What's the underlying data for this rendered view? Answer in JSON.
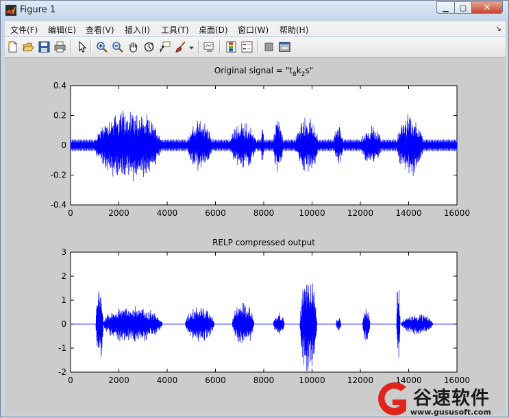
{
  "window": {
    "title": "Figure 1"
  },
  "menu": {
    "items": [
      "文件(F)",
      "编辑(E)",
      "查看(V)",
      "插入(I)",
      "工具(T)",
      "桌面(D)",
      "窗口(W)",
      "帮助(H)"
    ]
  },
  "toolbar": {
    "icons": [
      "new-figure-icon",
      "open-file-icon",
      "save-icon",
      "print-icon",
      "edit-plot-arrow-icon",
      "zoom-in-icon",
      "zoom-out-icon",
      "pan-hand-icon",
      "rotate-3d-icon",
      "data-cursor-icon",
      "brush-icon",
      "brush-dropdown-icon",
      "link-plot-icon",
      "colorbar-icon",
      "legend-icon",
      "hide-plot-tools-icon",
      "show-plot-tools-icon"
    ]
  },
  "colors": {
    "line": "#0000ff",
    "axes_bg": "#ffffff",
    "figure_bg": "#cccccc"
  },
  "watermark": {
    "text": "谷速软件",
    "url": "www.gususoft.com"
  },
  "chart_data": [
    {
      "type": "line",
      "title": "Original signal = \"t",
      "title_sub1": "8",
      "title_mid": "k",
      "title_sub2": "2",
      "title_end": "s\"",
      "xlim": [
        0,
        16000
      ],
      "ylim": [
        -0.4,
        0.4
      ],
      "xticks": [
        "0",
        "2000",
        "4000",
        "6000",
        "8000",
        "10000",
        "12000",
        "14000",
        "16000"
      ],
      "yticks": [
        "0.4",
        "0.2",
        "0",
        "-0.2",
        "-0.4"
      ],
      "baseline_amplitude": 0.04,
      "bursts": [
        {
          "start": 1000,
          "end": 3800,
          "amplitude": 0.26
        },
        {
          "start": 4800,
          "end": 5900,
          "amplitude": 0.18
        },
        {
          "start": 6600,
          "end": 7700,
          "amplitude": 0.17
        },
        {
          "start": 7900,
          "end": 8000,
          "amplitude": 0.15
        },
        {
          "start": 8400,
          "end": 8800,
          "amplitude": 0.2
        },
        {
          "start": 9300,
          "end": 10300,
          "amplitude": 0.2
        },
        {
          "start": 10900,
          "end": 11300,
          "amplitude": 0.14
        },
        {
          "start": 12000,
          "end": 12900,
          "amplitude": 0.14
        },
        {
          "start": 13500,
          "end": 14600,
          "amplitude": 0.22
        }
      ]
    },
    {
      "type": "line",
      "title": "RELP compressed output",
      "xlim": [
        0,
        16000
      ],
      "ylim": [
        -2,
        3
      ],
      "xticks": [
        "0",
        "2000",
        "4000",
        "6000",
        "8000",
        "10000",
        "12000",
        "14000",
        "16000"
      ],
      "yticks": [
        "3",
        "2",
        "1",
        "0",
        "-1",
        "-2"
      ],
      "bursts": [
        {
          "start": 1050,
          "end": 1350,
          "amplitude": 1.75
        },
        {
          "start": 1350,
          "end": 3800,
          "amplitude": 0.85
        },
        {
          "start": 4750,
          "end": 5950,
          "amplitude": 0.8
        },
        {
          "start": 6700,
          "end": 7600,
          "amplitude": 1.0
        },
        {
          "start": 8400,
          "end": 8850,
          "amplitude": 0.55
        },
        {
          "start": 9500,
          "end": 10200,
          "amplitude": 2.3
        },
        {
          "start": 11000,
          "end": 11200,
          "amplitude": 0.35
        },
        {
          "start": 12100,
          "end": 12400,
          "amplitude": 0.8
        },
        {
          "start": 13500,
          "end": 13650,
          "amplitude": 1.9
        },
        {
          "start": 13700,
          "end": 15000,
          "amplitude": 0.5
        }
      ]
    }
  ]
}
